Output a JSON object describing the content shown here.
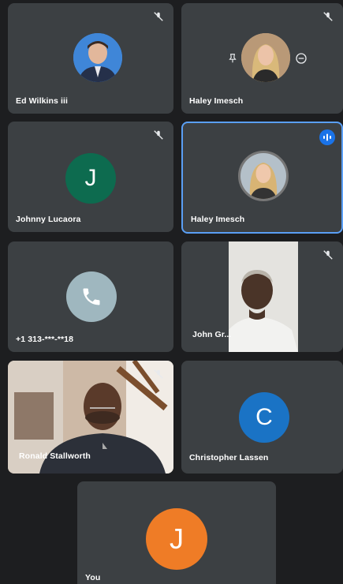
{
  "participants": [
    {
      "name": "Ed Wilkins iii",
      "muted": true
    },
    {
      "name": "Haley Imesch",
      "muted": true
    },
    {
      "name": "Johnny Lucaora",
      "initial": "J",
      "avatar_color": "#0d6b4f",
      "muted": true
    },
    {
      "name": "Haley Imesch",
      "speaking": true
    },
    {
      "name": "+1 313-***-**18",
      "avatar_color": "#9fb7bf"
    },
    {
      "name": "John Gr...",
      "muted": true
    },
    {
      "name": "Ronald Stallworth",
      "muted": true
    },
    {
      "name": "Christopher Lassen",
      "initial": "C",
      "avatar_color": "#1a73c5"
    },
    {
      "name": "You",
      "initial": "J",
      "avatar_color": "#ef7c26"
    }
  ],
  "colors": {
    "background": "#1d1e20",
    "tile": "#3c4043",
    "speaking_border": "#5a9ff5"
  }
}
